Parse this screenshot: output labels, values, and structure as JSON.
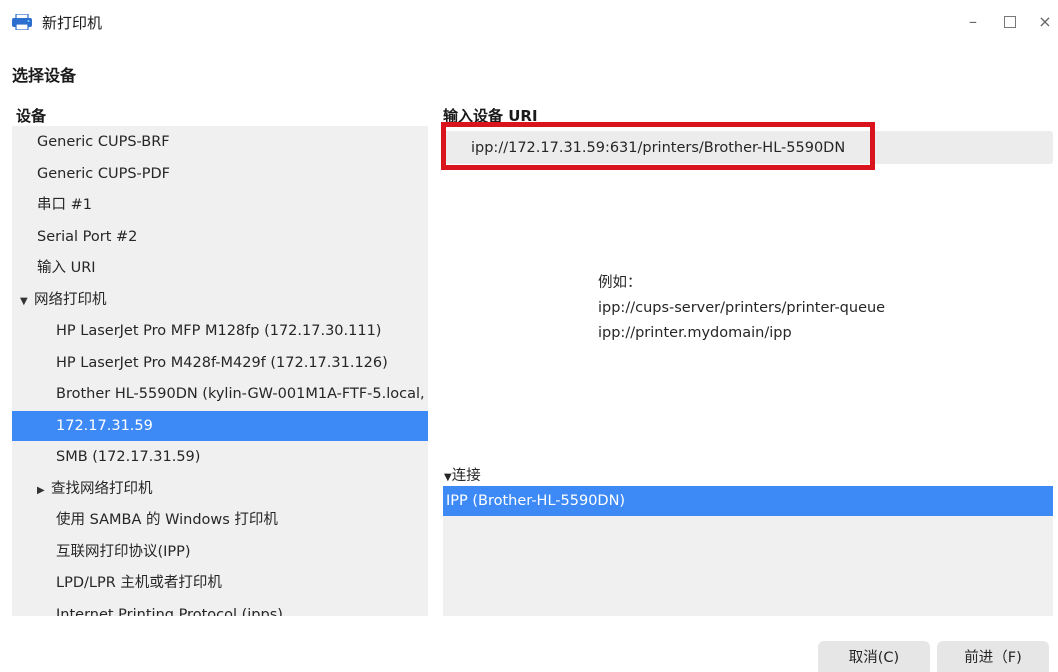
{
  "window": {
    "title": "新打印机",
    "icon": "printer-icon",
    "minimize_glyph": "–",
    "close_glyph": "×"
  },
  "section_title": "选择设备",
  "devices": {
    "label": "设备",
    "items": [
      {
        "label": "Generic CUPS-BRF",
        "indent": 1
      },
      {
        "label": "Generic CUPS-PDF",
        "indent": 1
      },
      {
        "label": "串口 #1",
        "indent": 1
      },
      {
        "label": "Serial Port #2",
        "indent": 1
      },
      {
        "label": "输入 URI",
        "indent": 1
      },
      {
        "label": "网络打印机",
        "indent": 0,
        "expander": "▼"
      },
      {
        "label": "HP LaserJet Pro MFP M128fp (172.17.30.111)",
        "indent": 2
      },
      {
        "label": "HP LaserJet Pro M428f-M429f (172.17.31.126)",
        "indent": 2
      },
      {
        "label": "Brother HL-5590DN (kylin-GW-001M1A-FTF-5.local,",
        "indent": 2
      },
      {
        "label": "172.17.31.59",
        "indent": 2,
        "selected": true
      },
      {
        "label": "SMB (172.17.31.59)",
        "indent": 2
      },
      {
        "label": "查找网络打印机",
        "indent": 1,
        "expander": "▶"
      },
      {
        "label": "使用 SAMBA 的 Windows 打印机",
        "indent": 2
      },
      {
        "label": "互联网打印协议(IPP)",
        "indent": 2
      },
      {
        "label": "LPD/LPR 主机或者打印机",
        "indent": 2
      },
      {
        "label": "Internet Printing Protocol (ipps)",
        "indent": 2
      }
    ]
  },
  "uri": {
    "label": "输入设备 URI",
    "value": "ipp://172.17.31.59:631/printers/Brother-HL-5590DN",
    "highlight_color": "#d9141c"
  },
  "example": {
    "heading": "例如：",
    "line1": "ipp://cups-server/printers/printer-queue",
    "line2": "ipp://printer.mydomain/ipp"
  },
  "connection": {
    "header": "连接",
    "expander": "▼",
    "selected": "IPP (Brother-HL-5590DN)"
  },
  "buttons": {
    "cancel": "取消(C)",
    "next": "前进（F)"
  },
  "colors": {
    "selection": "#3d8af7",
    "list_bg": "#f0f0f0"
  }
}
